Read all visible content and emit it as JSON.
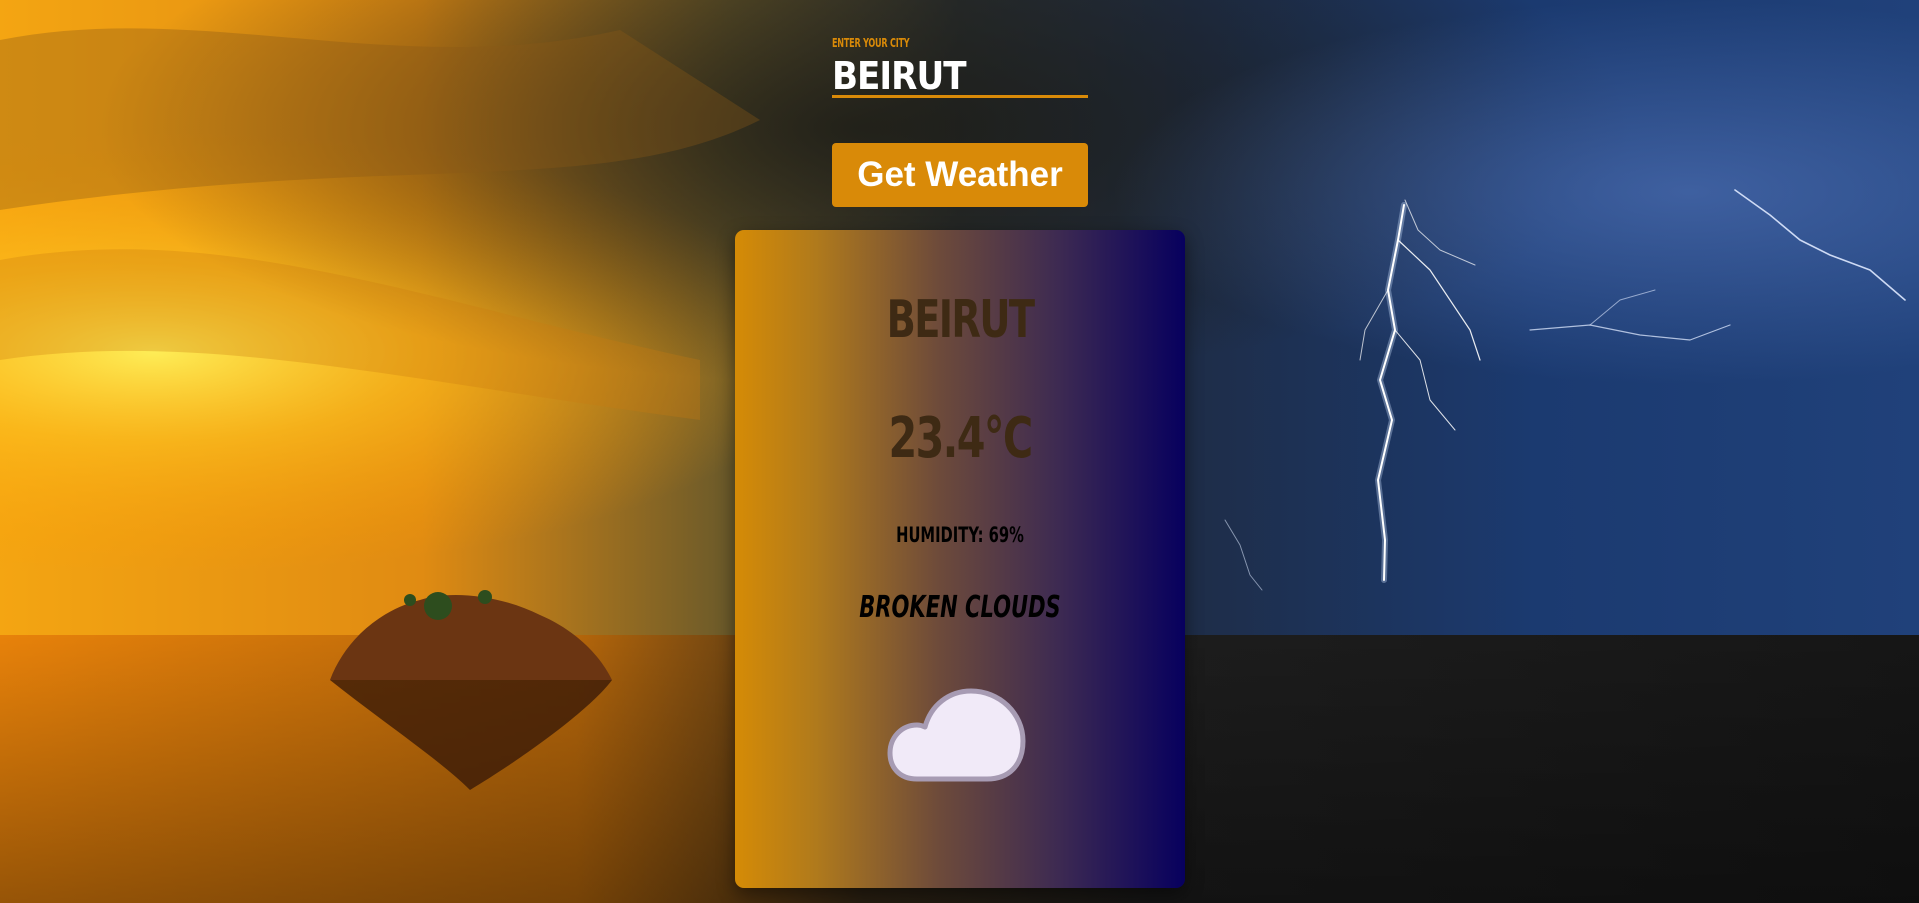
{
  "form": {
    "city_label": "Enter your city",
    "city_value": "BEIRUT",
    "button_label": "Get Weather"
  },
  "card": {
    "city": "BEIRUT",
    "temperature": "23.4°C",
    "humidity": "HUMIDITY: 69%",
    "description": "BROKEN CLOUDS",
    "icon": "cloud-icon"
  },
  "colors": {
    "accent": "#d98a08",
    "card_left": "#d58b06",
    "card_right": "#07005e"
  }
}
